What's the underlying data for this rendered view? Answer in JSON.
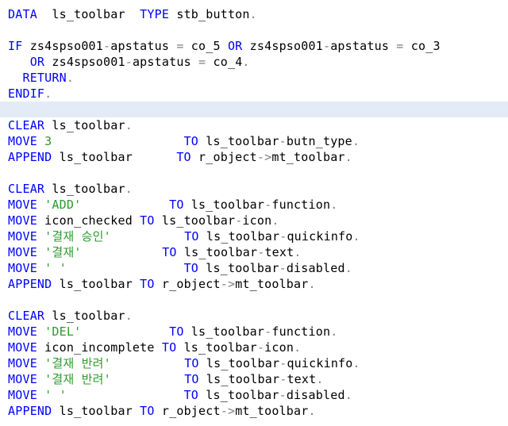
{
  "editor": {
    "highlight_color": "#e3ecf6",
    "keyword_color": "#0000ff",
    "string_color": "#2e9a2e",
    "lines": [
      {
        "t": "DATA  ls_toolbar  TYPE stb_button."
      },
      {
        "t": ""
      },
      {
        "t": "IF zs4spso001-apstatus = co_5 OR zs4spso001-apstatus = co_3"
      },
      {
        "t": "   OR zs4spso001-apstatus = co_4."
      },
      {
        "t": "  RETURN."
      },
      {
        "t": "ENDIF."
      },
      {
        "t": ""
      },
      {
        "t": "CLEAR ls_toolbar."
      },
      {
        "t": "MOVE 3                  TO ls_toolbar-butn_type."
      },
      {
        "t": "APPEND ls_toolbar      TO r_object->mt_toolbar."
      },
      {
        "t": ""
      },
      {
        "t": "CLEAR ls_toolbar."
      },
      {
        "t": "MOVE 'ADD'            TO ls_toolbar-function."
      },
      {
        "t": "MOVE icon_checked TO ls_toolbar-icon."
      },
      {
        "t": "MOVE '결재 승인'          TO ls_toolbar-quickinfo."
      },
      {
        "t": "MOVE '결재'           TO ls_toolbar-text."
      },
      {
        "t": "MOVE ' '                TO ls_toolbar-disabled."
      },
      {
        "t": "APPEND ls_toolbar TO r_object->mt_toolbar."
      },
      {
        "t": ""
      },
      {
        "t": "CLEAR ls_toolbar."
      },
      {
        "t": "MOVE 'DEL'            TO ls_toolbar-function."
      },
      {
        "t": "MOVE icon_incomplete TO ls_toolbar-icon."
      },
      {
        "t": "MOVE '결재 반려'          TO ls_toolbar-quickinfo."
      },
      {
        "t": "MOVE '결재 반려'          TO ls_toolbar-text."
      },
      {
        "t": "MOVE ' '                TO ls_toolbar-disabled."
      },
      {
        "t": "APPEND ls_toolbar TO r_object->mt_toolbar."
      }
    ]
  }
}
